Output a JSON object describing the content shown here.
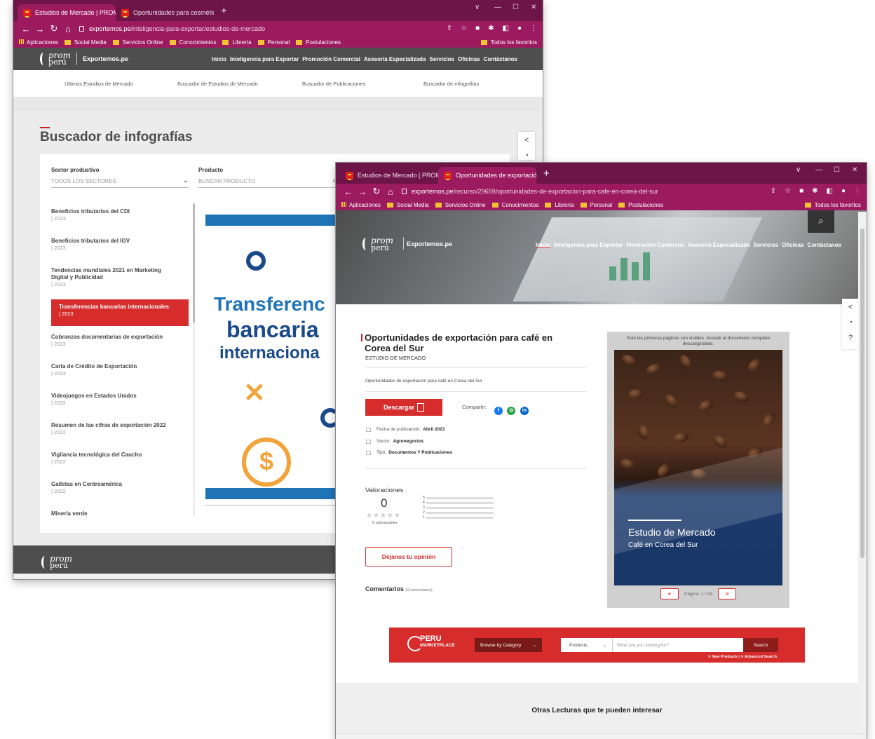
{
  "w1": {
    "tabs": [
      {
        "title": "Estudios de Mercado | PROMPERÚ",
        "close": "×"
      },
      {
        "title": "Oportunidades para cosmética ·",
        "close": "×"
      }
    ],
    "newtab": "+",
    "url_host": "exportemos.pe",
    "url_path": "/inteligencia-para-exportar/estudios-de-mercado",
    "bookmarks": [
      "Aplicaciones",
      "Social Media",
      "Servicios Online",
      "Conocimientos",
      "Librería",
      "Personal",
      "Postulaciones"
    ],
    "bookmarks_right": "Todos los favoritos",
    "site": {
      "logo_top": "prom",
      "logo_bottom": "perú",
      "brand": "Exportemos.pe",
      "nav": [
        "Inicio",
        "Inteligencia para Exportar",
        "Promoción Comercial",
        "Asesoría Especializada",
        "Servicios",
        "Oficinas",
        "Contáctanos"
      ],
      "subnav": [
        "Últimos Estudios de Mercado",
        "Buscador de Estudios de Mercado",
        "Buscador de Publicaciones",
        "Buscador de infografías"
      ]
    },
    "page_title": "Buscador de infografías",
    "filters": {
      "sector_label": "Sector productivo",
      "sector_value": "TODOS LOS SECTORES",
      "product_label": "Producto",
      "product_placeholder": "BUSCAR PRODUCTO"
    },
    "list": [
      {
        "title": "Beneficios tributarios del CDI",
        "year": "| 2023"
      },
      {
        "title": "Beneficios tributarios del IGV",
        "year": "| 2023"
      },
      {
        "title": "Tendencias mundiales 2021 en Marketing Digital y Publicidad",
        "year": "| 2023"
      },
      {
        "title": "Transferencias bancarias internacionales",
        "year": "| 2023",
        "selected": true
      },
      {
        "title": "Cobranzas documentarias de exportación",
        "year": "| 2023"
      },
      {
        "title": "Carta de Crédito de Exportación",
        "year": "| 2023"
      },
      {
        "title": "Videojuegos en Estados Unidos",
        "year": "| 2022"
      },
      {
        "title": "Resumen de las cifras de exportación 2022",
        "year": "| 2022"
      },
      {
        "title": "Vigilancia tecnológica del Caucho",
        "year": "| 2022"
      },
      {
        "title": "Galletas en Centroamérica",
        "year": "| 2022"
      },
      {
        "title": "Minería verde",
        "year": ""
      }
    ],
    "infographic": {
      "line1": "Transferenc",
      "line2": "bancaria",
      "line3": "internaciona"
    }
  },
  "w2": {
    "tabs": [
      {
        "title": "Estudios de Mercado | PROMPER",
        "close": "×"
      },
      {
        "title": "Oportunidades de exportación ·",
        "close": "×"
      }
    ],
    "newtab": "+",
    "url_host": "exportemos.pe",
    "url_path": "/recurso/29659/oportunidades-de-exportacion-para-cafe-en-corea-del-sur",
    "bookmarks": [
      "Aplicaciones",
      "Social Media",
      "Servicios Online",
      "Conocimientos",
      "Librería",
      "Personal",
      "Postulaciones"
    ],
    "bookmarks_right": "Todos los favoritos",
    "site": {
      "logo_top": "prom",
      "logo_bottom": "perú",
      "brand": "Exportemos.pe",
      "nav": [
        "Inicio",
        "Inteligencia para Exportar",
        "Promoción Comercial",
        "Asesoría Especializada",
        "Servicios",
        "Oficinas",
        "Contáctanos"
      ]
    },
    "doc": {
      "title": "Oportunidades de exportación para café en Corea del Sur",
      "type": "ESTUDIO DE MERCADO",
      "summary": "Oportunidades de exportación para café en Corea del Sur",
      "download": "Descargar",
      "share": "Compartir:",
      "date_label": "Fecha de publicación:",
      "date": "Abril 2023",
      "sector_label": "Sector:",
      "sector": "Agronegocios",
      "tipo_label": "Tipo:",
      "tipo": "Documentos Y Publicaciones"
    },
    "ratings": {
      "title": "Valoraciones",
      "score": "0",
      "count": "0 valoraciones",
      "levels": [
        "5",
        "4",
        "3",
        "2",
        "1"
      ],
      "stars": "★★★★★"
    },
    "opinion_btn": "Déjanos tu opinión",
    "comments": {
      "title": "Comentarios",
      "count": "(0 comentarios)"
    },
    "viewer": {
      "note": "Solo las primeras páginas son visibles. Accede al documento completo descargándolo.",
      "cover_title": "Estudio de Mercado",
      "cover_sub": "Café en Corea del Sur",
      "prev": "«",
      "next": "»",
      "page": "Página: 1 / 53"
    },
    "marketplace": {
      "logo": "PERU",
      "logo_sub": "MARKETPLACE",
      "browse": "Browse by Category",
      "products": "Products",
      "placeholder": "What are you looking for?",
      "search": "Search",
      "links": "∨ New Products   |   ∨ Advanced Search"
    },
    "otras_title": "Otras Lecturas que te pueden interesar"
  }
}
